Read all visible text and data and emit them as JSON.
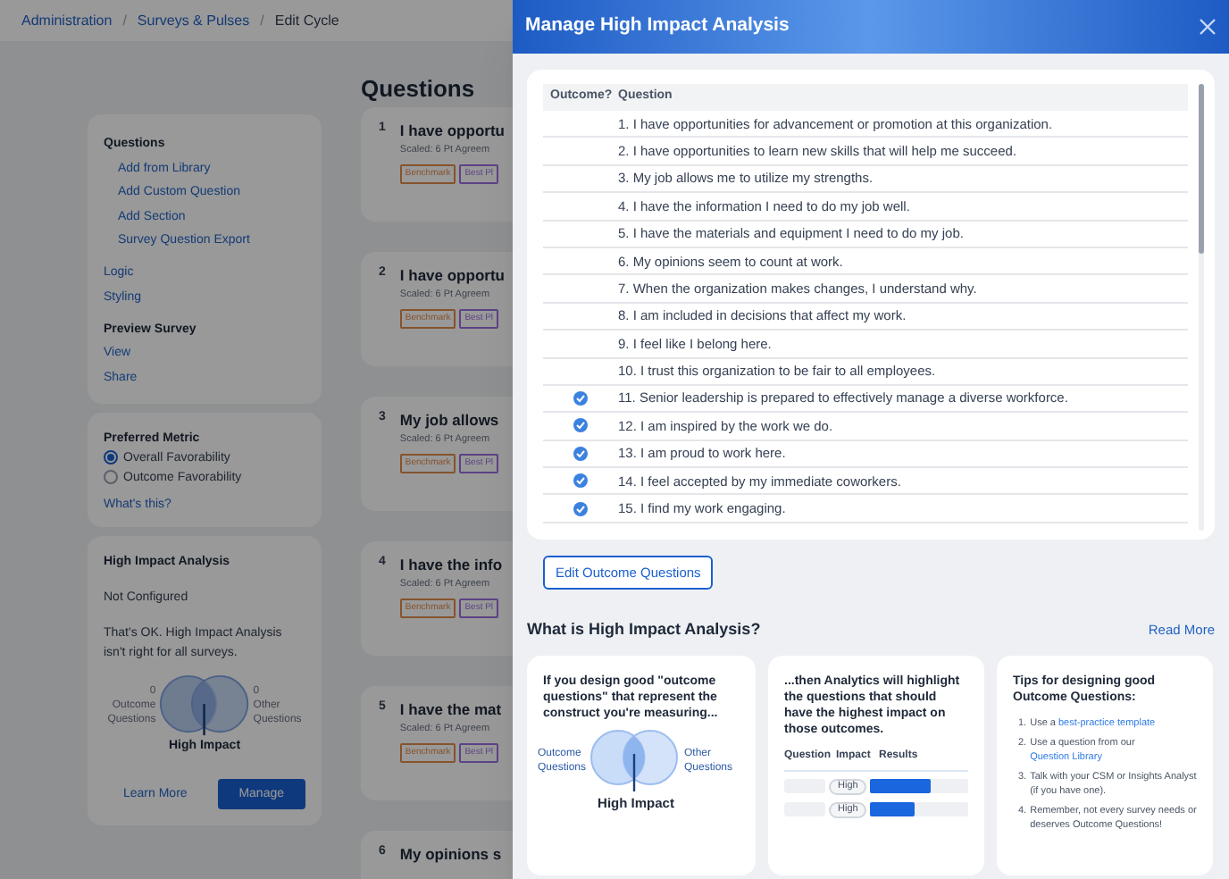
{
  "breadcrumb": [
    {
      "label": "Administration",
      "kind": "link"
    },
    {
      "label": "/",
      "kind": "separator"
    },
    {
      "label": "Surveys & Pulses",
      "kind": "link"
    },
    {
      "label": "/",
      "kind": "separator"
    },
    {
      "label": "Edit Cycle",
      "kind": "current"
    }
  ],
  "sidebar": {
    "sections": [
      {
        "title": "Questions",
        "children": [
          "Add from Library",
          "Add Custom Question",
          "Add Section",
          "Survey Question Export"
        ]
      },
      {
        "links": [
          "Logic",
          "Styling"
        ]
      },
      {
        "title": "Preview Survey",
        "links": [
          "View",
          "Share"
        ]
      }
    ]
  },
  "preferred_metric": {
    "title": "Preferred Metric",
    "options": [
      {
        "label": "Overall Favorability",
        "selected": true
      },
      {
        "label": "Outcome Favorability",
        "selected": false
      }
    ],
    "link": "What's this?"
  },
  "high_impact_card": {
    "title": "High Impact Analysis",
    "status": "Not Configured",
    "description": "That's OK. High Impact Analysis isn't right for all surveys.",
    "left_count": "0",
    "left_label": "Outcome Questions",
    "right_count": "0",
    "right_label": "Other Questions",
    "center_label": "High Impact",
    "learn_more": "Learn More",
    "manage": "Manage"
  },
  "questions_heading": "Questions",
  "question_cards": [
    {
      "number": "1",
      "title": "I have opportu",
      "subtitle": "Scaled: 6 Pt Agreem",
      "tags": [
        {
          "label": "Benchmark",
          "kind": "benchmark"
        },
        {
          "label": "Best Pl",
          "kind": "best_practice"
        }
      ]
    },
    {
      "number": "2",
      "title": "I have opportu",
      "subtitle": "Scaled: 6 Pt Agreem",
      "tags": [
        {
          "label": "Benchmark",
          "kind": "benchmark"
        },
        {
          "label": "Best Pl",
          "kind": "best_practice"
        }
      ]
    },
    {
      "number": "3",
      "title": "My job allows",
      "subtitle": "Scaled: 6 Pt Agreem",
      "tags": [
        {
          "label": "Benchmark",
          "kind": "benchmark"
        },
        {
          "label": "Best Pl",
          "kind": "best_practice"
        }
      ]
    },
    {
      "number": "4",
      "title": "I have the info",
      "subtitle": "Scaled: 6 Pt Agreem",
      "tags": [
        {
          "label": "Benchmark",
          "kind": "benchmark"
        },
        {
          "label": "Best Pl",
          "kind": "best_practice"
        }
      ]
    },
    {
      "number": "5",
      "title": "I have the mat",
      "subtitle": "Scaled: 6 Pt Agreem",
      "tags": [
        {
          "label": "Benchmark",
          "kind": "benchmark"
        },
        {
          "label": "Best Pl",
          "kind": "best_practice"
        }
      ]
    },
    {
      "number": "6",
      "title": "My opinions s"
    }
  ],
  "modal": {
    "title": "Manage High Impact Analysis",
    "table": {
      "columns": [
        "Outcome?",
        "Question"
      ],
      "rows": [
        {
          "outcome": false,
          "question": "1. I have opportunities for advancement or promotion at this organization."
        },
        {
          "outcome": false,
          "question": "2. I have opportunities to learn new skills that will help me succeed."
        },
        {
          "outcome": false,
          "question": "3. My job allows me to utilize my strengths."
        },
        {
          "outcome": false,
          "question": "4. I have the information I need to do my job well."
        },
        {
          "outcome": false,
          "question": "5. I have the materials and equipment I need to do my job."
        },
        {
          "outcome": false,
          "question": "6. My opinions seem to count at work."
        },
        {
          "outcome": false,
          "question": "7. When the organization makes changes, I understand why."
        },
        {
          "outcome": false,
          "question": "8. I am included in decisions that affect my work."
        },
        {
          "outcome": false,
          "question": "9. I feel like I belong here."
        },
        {
          "outcome": false,
          "question": "10. I trust this organization to be fair to all employees."
        },
        {
          "outcome": true,
          "question": "11. Senior leadership is prepared to effectively manage a diverse workforce."
        },
        {
          "outcome": true,
          "question": "12. I am inspired by the work we do."
        },
        {
          "outcome": true,
          "question": "13. I am proud to work here."
        },
        {
          "outcome": true,
          "question": "14. I feel accepted by my immediate coworkers."
        },
        {
          "outcome": true,
          "question": "15. I find my work engaging."
        }
      ]
    },
    "edit_button": "Edit Outcome Questions",
    "info_heading": "What is High Impact Analysis?",
    "read_more": "Read More",
    "card_1": {
      "text": "If you design good \"outcome questions\" that represent the construct you're measuring...",
      "left_label": "Outcome Questions",
      "right_label": "Other Questions",
      "center_label": "High Impact"
    },
    "card_2": {
      "text": "...then Analytics will highlight the questions that should have the highest impact on those outcomes.",
      "columns": [
        "Question",
        "Impact",
        "Results"
      ],
      "rows": [
        {
          "impact": "High",
          "level": 0.62
        },
        {
          "impact": "High",
          "level": 0.45
        }
      ]
    },
    "card_3": {
      "title": "Tips for designing good Outcome Questions:",
      "tips": [
        {
          "number": "1.",
          "text": "Use a",
          "link": "best-practice template"
        },
        {
          "number": "2.",
          "text": "Use a question from our",
          "link": "Question Library"
        },
        {
          "number": "3.",
          "text": "Talk with your CSM or Insights Analyst (if you have one)."
        },
        {
          "number": "4.",
          "text": "Remember, not every survey needs or deserves Outcome Questions!"
        }
      ]
    }
  }
}
